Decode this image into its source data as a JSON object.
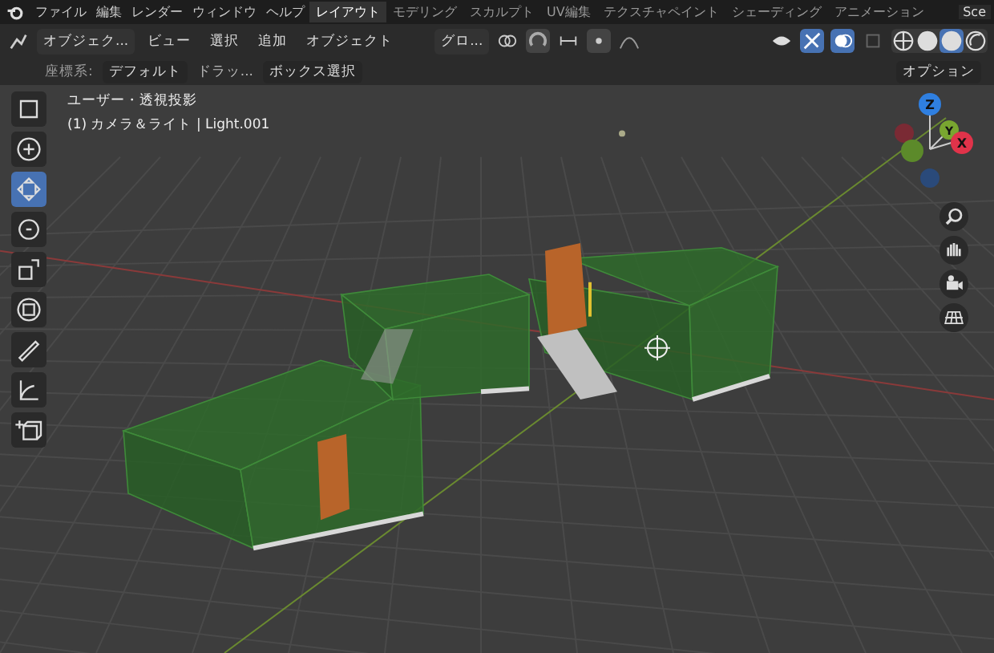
{
  "menu": [
    "ファイル",
    "編集",
    "レンダー",
    "ウィンドウ",
    "ヘルプ"
  ],
  "workspaces": [
    {
      "label": "レイアウト",
      "selected": true
    },
    {
      "label": "モデリング",
      "selected": false
    },
    {
      "label": "スカルプト",
      "selected": false
    },
    {
      "label": "UV編集",
      "selected": false
    },
    {
      "label": "テクスチャペイント",
      "selected": false
    },
    {
      "label": "シェーディング",
      "selected": false
    },
    {
      "label": "アニメーション",
      "selected": false
    }
  ],
  "scene_field": "Sce",
  "header": {
    "mode": "オブジェク...",
    "menus": [
      "ビュー",
      "選択",
      "追加",
      "オブジェクト"
    ],
    "transform": "グロ..."
  },
  "tool_settings": {
    "label": "座標系:",
    "orientation": "デフォルト",
    "drag": "ドラッ...",
    "select": "ボックス選択",
    "options": "オプション"
  },
  "viewport": {
    "view_name": "ユーザー・透視投影",
    "object_info": "(1) カメラ＆ライト | Light.001"
  },
  "tools": [
    {
      "kind": "select",
      "selected": false
    },
    {
      "kind": "cursor",
      "selected": false
    },
    {
      "kind": "move",
      "selected": true
    },
    {
      "kind": "rotate",
      "selected": false
    },
    {
      "kind": "scale",
      "selected": false
    },
    {
      "kind": "transform",
      "selected": false
    },
    {
      "kind": "annotate",
      "selected": false
    },
    {
      "kind": "measure",
      "selected": false
    },
    {
      "kind": "add",
      "selected": false
    }
  ],
  "shading": [
    {
      "kind": "wire",
      "selected": false
    },
    {
      "kind": "solid",
      "selected": false
    },
    {
      "kind": "material",
      "selected": true
    },
    {
      "kind": "render",
      "selected": false
    }
  ],
  "gizmo": {
    "x": "X",
    "y": "Y",
    "z": "Z"
  }
}
